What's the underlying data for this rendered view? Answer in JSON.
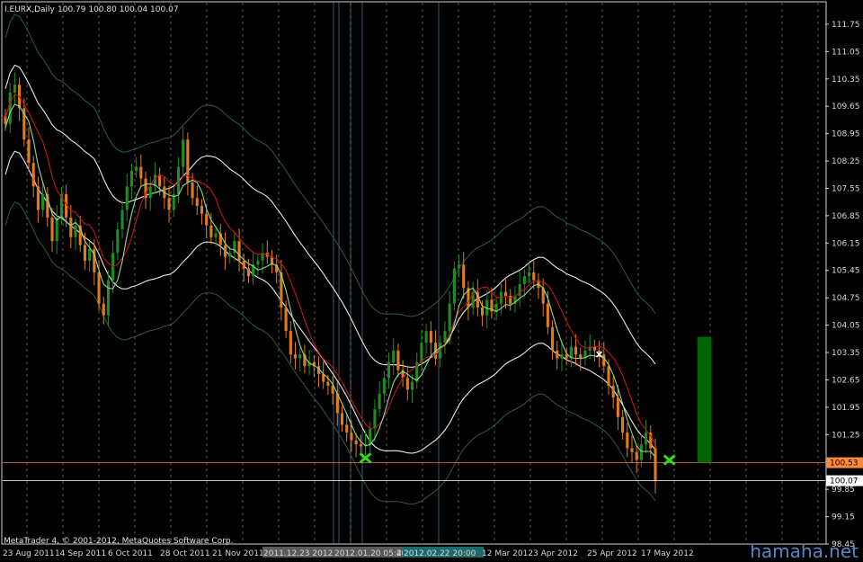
{
  "chart_data": {
    "type": "candlestick",
    "header": {
      "symbol": "I.EURX,Daily",
      "quote": "100.79 100.80 100.04 100.07"
    },
    "copyright": "MetaTrader 4, © 2001-2012, MetaQuotes Software Corp.",
    "watermark": "hamaha.net",
    "ylim": [
      98.45,
      112.3
    ],
    "y_ticks": [
      "111.75",
      "111.05",
      "110.35",
      "109.65",
      "108.95",
      "108.25",
      "107.55",
      "106.85",
      "106.15",
      "105.45",
      "104.75",
      "104.05",
      "103.35",
      "102.65",
      "101.95",
      "101.25",
      "100.55",
      "99.85",
      "99.15",
      "98.45"
    ],
    "price_labels": [
      {
        "value": 100.53,
        "text": "100.53",
        "color": "#ff8a3a"
      },
      {
        "value": 100.07,
        "text": "100.07",
        "color": "#ffffff"
      }
    ],
    "x_ticks": [
      "23 Aug 2011",
      "14 Sep 2011",
      "6 Oct 2011",
      "28 Oct 2011",
      "21 Nov 2011",
      "2011.12.23 2012.0",
      "2012.01.20 05:48",
      "20",
      "2012.02.22 20:00",
      "12 Mar 2012",
      "3 Apr 2012",
      "25 Apr 2012",
      "17 May 2012"
    ],
    "highlighted_x_ticks": [
      "2011.12.23 2012.0",
      "2012.01.20 05:48",
      "2012.02.22 20:00"
    ],
    "colors": {
      "bull": "#228b22",
      "bear": "#e07b21",
      "ma_red": "#c01818",
      "ma_green": "#8fd88f",
      "band_white": "#e8e8e8",
      "band_outer": "#2e5a4a",
      "signal": "#37d61c",
      "box": "#006400",
      "grid": "#c8c8c8"
    },
    "closes": [
      109.2,
      110.0,
      110.2,
      109.6,
      108.8,
      108.2,
      107.6,
      107.0,
      107.4,
      106.8,
      106.2,
      106.8,
      107.4,
      106.8,
      106.3,
      106.6,
      106.1,
      105.7,
      106.0,
      105.4,
      104.6,
      104.3,
      105.2,
      105.9,
      106.5,
      107.0,
      107.6,
      108.0,
      108.1,
      107.8,
      107.3,
      107.6,
      107.9,
      107.6,
      107.3,
      107.0,
      107.4,
      108.1,
      108.8,
      107.7,
      107.3,
      107.1,
      106.9,
      106.6,
      106.3,
      106.4,
      106.1,
      105.8,
      105.9,
      106.2,
      105.7,
      105.5,
      105.3,
      105.6,
      105.7,
      105.9,
      105.8,
      105.6,
      105.4,
      104.5,
      103.9,
      103.3,
      103.2,
      103.3,
      103.0,
      103.1,
      103.0,
      102.8,
      102.6,
      102.5,
      102.3,
      101.8,
      101.5,
      101.3,
      101.1,
      101.0,
      100.95,
      101.0,
      101.4,
      101.9,
      102.3,
      102.7,
      103.1,
      103.4,
      102.9,
      102.7,
      102.4,
      102.6,
      103.1,
      103.6,
      103.9,
      103.6,
      103.2,
      103.6,
      103.9,
      104.6,
      105.5,
      105.6,
      105.0,
      104.5,
      104.9,
      104.5,
      104.3,
      104.7,
      104.4,
      104.6,
      104.9,
      104.8,
      104.6,
      104.8,
      105.1,
      105.3,
      105.4,
      105.2,
      105.0,
      104.6,
      104.0,
      103.4,
      103.2,
      103.3,
      103.2,
      103.5,
      103.3,
      103.2,
      103.4,
      103.5,
      103.4,
      103.3,
      103.0,
      102.5,
      102.2,
      101.7,
      101.3,
      100.9,
      100.8,
      100.6,
      101.0,
      101.3,
      100.9,
      100.07
    ],
    "signals": [
      {
        "type": "x-marker",
        "index": 77,
        "price": 100.65
      },
      {
        "type": "x-marker",
        "index": 142,
        "price": 100.6
      },
      {
        "type": "x-marker-small",
        "index": 127,
        "price": 103.3,
        "color": "#ffffff"
      }
    ],
    "box": {
      "from_index": 148,
      "to_index": 151,
      "top": 103.75,
      "bottom": 100.53
    }
  }
}
